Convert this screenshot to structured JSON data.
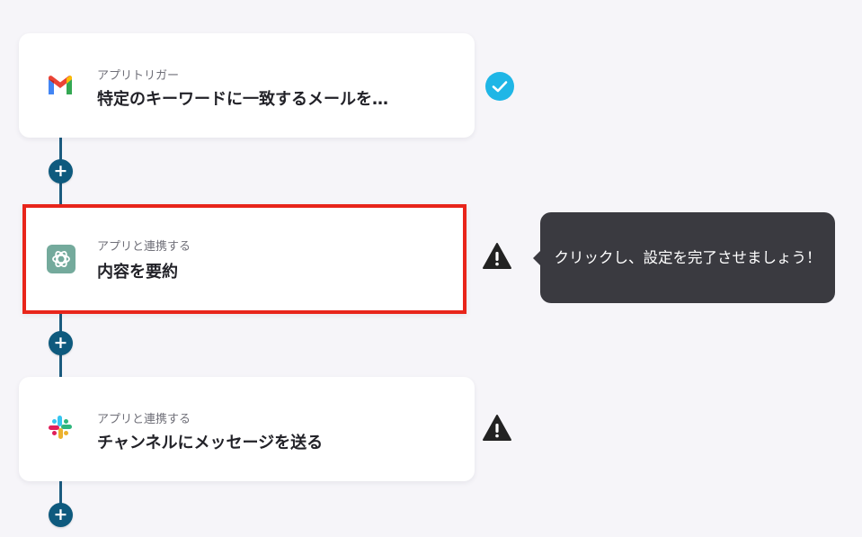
{
  "steps": [
    {
      "label": "アプリトリガー",
      "title": "特定のキーワードに一致するメールを…",
      "app_icon": "gmail-icon",
      "status": "complete",
      "status_icon": "check-circle-icon"
    },
    {
      "label": "アプリと連携する",
      "title": "内容を要約",
      "app_icon": "chatgpt-icon",
      "status": "warning",
      "status_icon": "warning-triangle-icon"
    },
    {
      "label": "アプリと連携する",
      "title": "チャンネルにメッセージを送る",
      "app_icon": "slack-icon",
      "status": "warning",
      "status_icon": "warning-triangle-icon"
    }
  ],
  "add_button": {
    "symbol": "+",
    "icon": "plus-icon"
  },
  "tooltip": {
    "text": "クリックし、設定を完了させましょう！"
  },
  "colors": {
    "background": "#f6f5f9",
    "connector": "#1b5b7f",
    "add_button": "#0e5a7e",
    "check": "#1fb6e6",
    "warning": "#222222",
    "highlight_border": "#e8251b",
    "tooltip_bg": "#3a3a40"
  }
}
